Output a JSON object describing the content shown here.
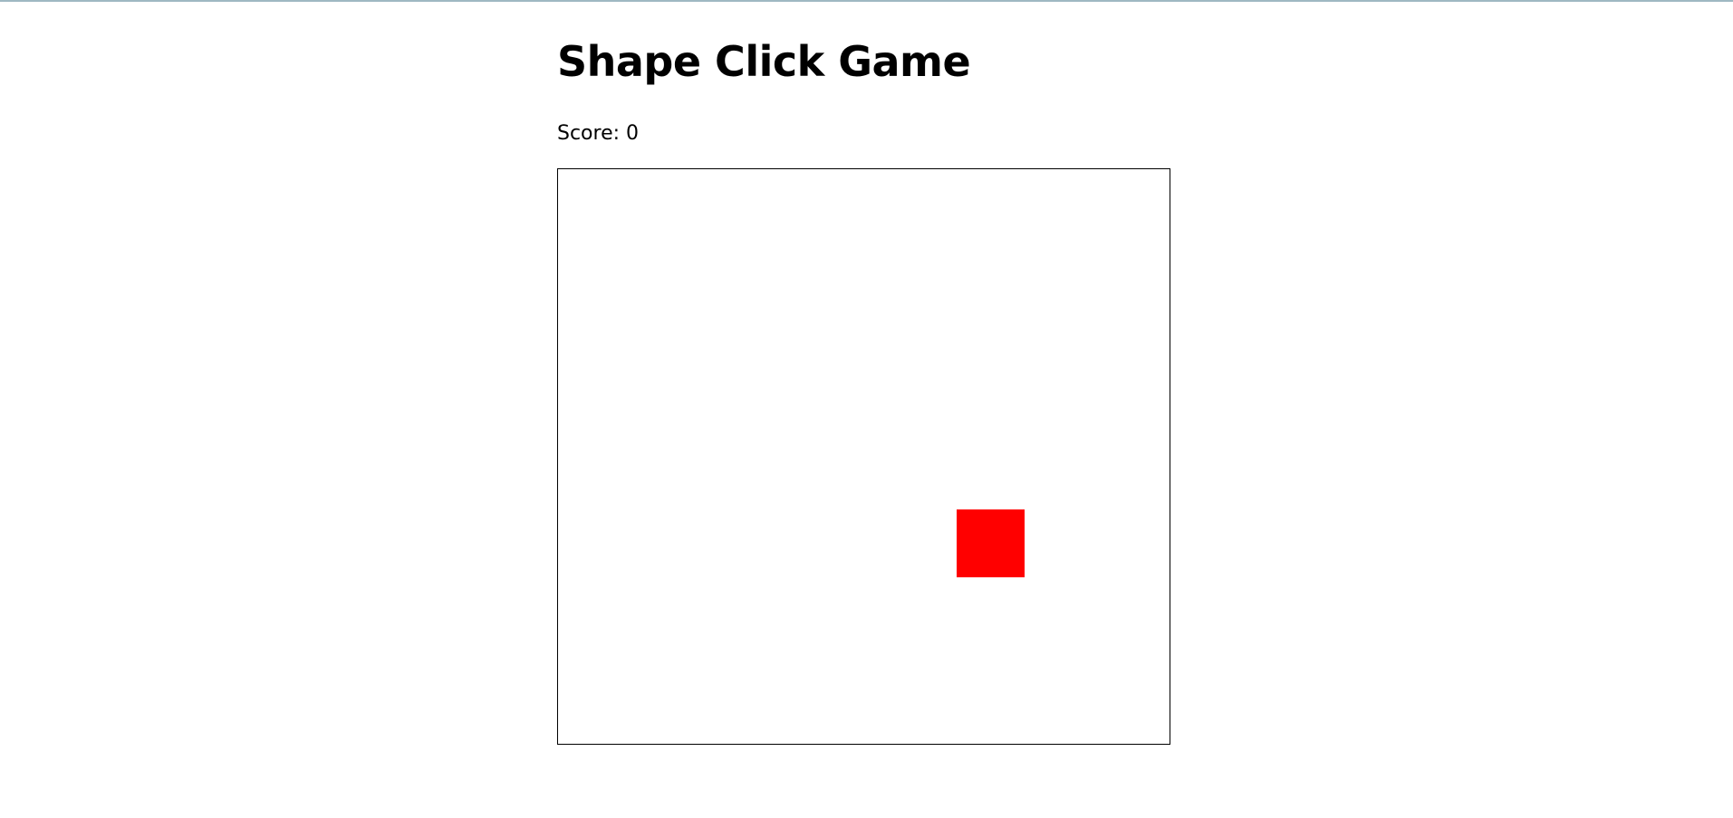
{
  "game": {
    "title": "Shape Click Game",
    "score_label": "Score:",
    "score": 0
  },
  "target": {
    "shape": "square",
    "color": "#ff0000"
  }
}
